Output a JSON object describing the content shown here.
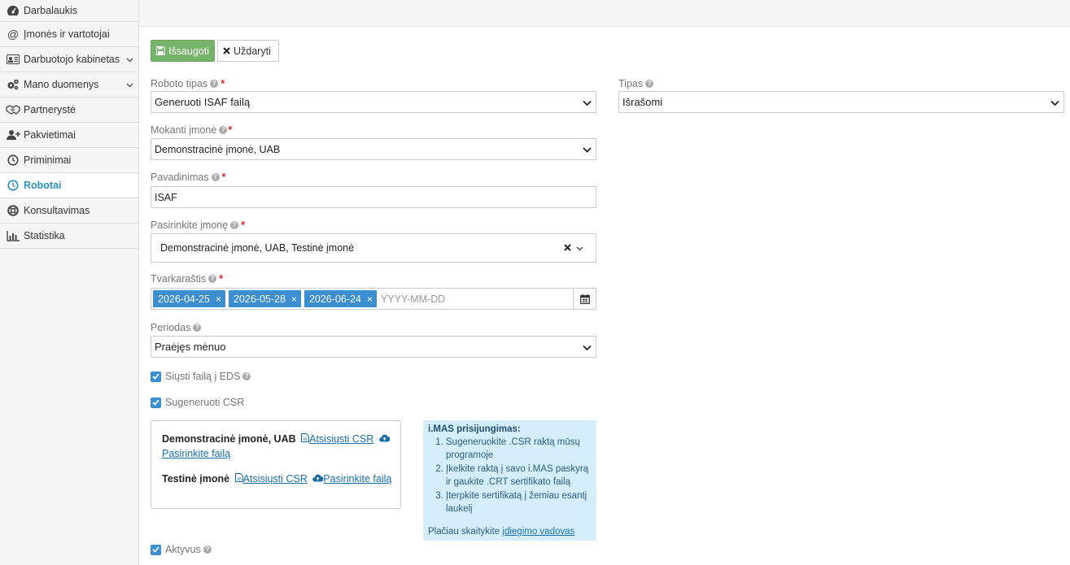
{
  "sidebar": {
    "items": [
      {
        "label": "Darbalaukis",
        "icon": "dashboard-icon",
        "active": false,
        "has_chevron": false
      },
      {
        "label": "Įmonės ir vartotojai",
        "icon": "at-icon",
        "active": false,
        "has_chevron": false
      },
      {
        "label": "Darbuotojo kabinetas",
        "icon": "id-card-icon",
        "active": false,
        "has_chevron": true
      },
      {
        "label": "Mano duomenys",
        "icon": "gears-icon",
        "active": false,
        "has_chevron": true
      },
      {
        "label": "Partnerystė",
        "icon": "handshake-icon",
        "active": false,
        "has_chevron": false
      },
      {
        "label": "Pakvietimai",
        "icon": "user-plus-icon",
        "active": false,
        "has_chevron": false
      },
      {
        "label": "Priminimai",
        "icon": "clock-icon",
        "active": false,
        "has_chevron": false
      },
      {
        "label": "Robotai",
        "icon": "clock-icon",
        "active": true,
        "has_chevron": false
      },
      {
        "label": "Konsultavimas",
        "icon": "lifebuoy-icon",
        "active": false,
        "has_chevron": false
      },
      {
        "label": "Statistika",
        "icon": "bar-chart-icon",
        "active": false,
        "has_chevron": false
      }
    ]
  },
  "toolbar": {
    "save_label": "Išsaugoti",
    "close_label": "Uždaryti"
  },
  "form": {
    "robot_type": {
      "label": "Roboto tipas",
      "value": "Generuoti ISAF failą"
    },
    "type": {
      "label": "Tipas",
      "value": "Išrašomi"
    },
    "paying_company": {
      "label": "Mokanti įmonė",
      "value": "Demonstracinė įmonė, UAB"
    },
    "name": {
      "label": "Pavadinimas",
      "value": "ISAF"
    },
    "select_company": {
      "label": "Pasirinkite įmonę",
      "value": "Demonstracinė įmonė, UAB, Testinė įmonė"
    },
    "schedule": {
      "label": "Tvarkaraštis",
      "dates": [
        "2026-04-25",
        "2026-05-28",
        "2026-06-24"
      ],
      "placeholder": "YYYY-MM-DD"
    },
    "period": {
      "label": "Periodas",
      "value": "Praėjęs mėnuo"
    },
    "send_eds": {
      "label": "Siųsti failą į EDS",
      "checked": true
    },
    "generate_csr": {
      "label": "Sugeneruoti CSR",
      "checked": true
    },
    "active": {
      "label": "Aktyvus",
      "checked": true
    }
  },
  "csr_panel": {
    "company1": "Demonstracinė įmonė, UAB",
    "company2": "Testinė įmonė",
    "download_csr": "Atsisiųsti CSR",
    "choose_file": "Pasirinkite failą"
  },
  "info_box": {
    "title": "i.MAS prisijungimas:",
    "steps": [
      "Sugeneruokite .CSR raktą mūsų programoje",
      "Įkelkite raktą į savo i.MAS paskyrą ir gaukite .CRT sertifikato failą",
      "Įterpkite sertifikatą į žemiau esantį laukelį"
    ],
    "more_prefix": "Plačiau skaitykite ",
    "more_link": "įdiegimo vadovas"
  },
  "colors": {
    "accent": "#2a8fbd",
    "save_button": "#77b46b",
    "tag": "#3b8ed0",
    "required": "#d9232d",
    "info_bg": "#d5eefb"
  }
}
